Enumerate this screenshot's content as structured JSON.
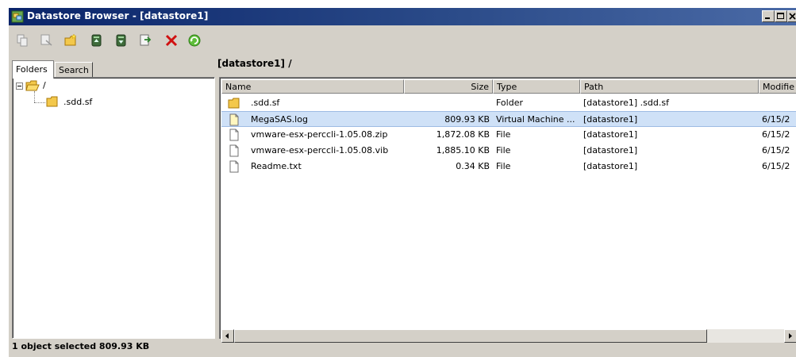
{
  "window": {
    "title": "Datastore Browser - [datastore1]",
    "accent": "#0a246a"
  },
  "toolbar": {
    "tools": [
      "copy-icon",
      "cut-icon",
      "new-folder-icon",
      "upload-icon",
      "download-icon",
      "move-icon",
      "delete-icon",
      "refresh-icon"
    ]
  },
  "tabs": {
    "folders": "Folders",
    "search": "Search"
  },
  "tree": {
    "root": "/",
    "child": ".sdd.sf"
  },
  "current_path": "[datastore1] /",
  "columns": {
    "name": "Name",
    "size": "Size",
    "type": "Type",
    "path": "Path",
    "modified": "Modifie"
  },
  "files": [
    {
      "icon": "folder-icon",
      "name": ".sdd.sf",
      "size": "",
      "type": "Folder",
      "path": "[datastore1] .sdd.sf",
      "modified": ""
    },
    {
      "icon": "log-file-icon",
      "name": "MegaSAS.log",
      "size": "809.93 KB",
      "type": "Virtual Machine ...",
      "path": "[datastore1]",
      "modified": "6/15/2"
    },
    {
      "icon": "file-icon",
      "name": "vmware-esx-perccli-1.05.08.zip",
      "size": "1,872.08 KB",
      "type": "File",
      "path": "[datastore1]",
      "modified": "6/15/2"
    },
    {
      "icon": "file-icon",
      "name": "vmware-esx-perccli-1.05.08.vib",
      "size": "1,885.10 KB",
      "type": "File",
      "path": "[datastore1]",
      "modified": "6/15/2"
    },
    {
      "icon": "file-icon",
      "name": "Readme.txt",
      "size": "0.34 KB",
      "type": "File",
      "path": "[datastore1]",
      "modified": "6/15/2"
    }
  ],
  "selected_row": 1,
  "status": "1 object selected 809.93 KB"
}
